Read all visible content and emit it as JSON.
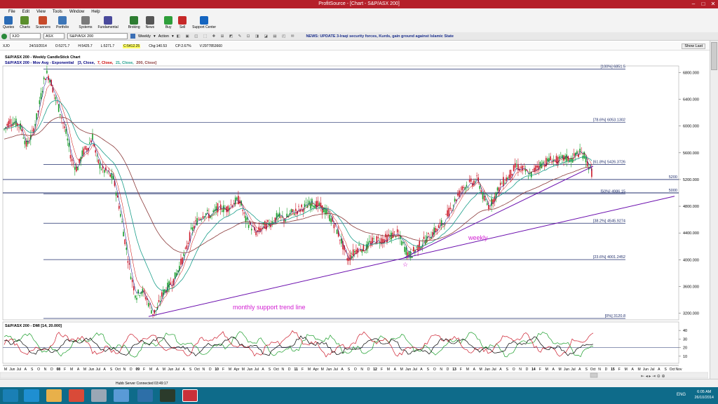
{
  "window": {
    "title": "ProfitSource - [Chart - S&P/ASX 200]"
  },
  "menu": [
    "File",
    "Edit",
    "View",
    "Tools",
    "Window",
    "Help"
  ],
  "toolbar": [
    {
      "label": "Quotes",
      "icon": "quotes-icon",
      "color": "#2a6bb5"
    },
    {
      "label": "Charts",
      "icon": "charts-icon",
      "color": "#5b8f2d"
    },
    {
      "label": "Scanners",
      "icon": "scanners-icon",
      "color": "#c74a2a"
    },
    {
      "label": "Portfolio",
      "icon": "portfolio-icon",
      "color": "#3d76b8"
    },
    {
      "label": "Systems",
      "icon": "systems-icon",
      "color": "#7a7a7a"
    },
    {
      "label": "Fundamental",
      "icon": "fundamental-icon",
      "color": "#4a4a9c"
    },
    {
      "label": "Broking",
      "icon": "broking-icon",
      "color": "#2e7d32"
    },
    {
      "label": "News",
      "icon": "news-icon",
      "color": "#555555"
    },
    {
      "label": "Buy",
      "icon": "buy-icon",
      "color": "#2e9e3a"
    },
    {
      "label": "Sell",
      "icon": "sell-icon",
      "color": "#c62828"
    },
    {
      "label": "Support Center",
      "icon": "help-icon",
      "color": "#1565c0"
    }
  ],
  "symbolbar": {
    "symbol": "XJO",
    "exchange": "ASX",
    "name": "S&P/ASX 200",
    "period": "Weekly",
    "action": "Action",
    "news": "NEWS: UPDATE 3-Iraqi security forces, Kurds, gain ground against Islamic State"
  },
  "quote": {
    "code": "XJO",
    "date": "24/10/2014",
    "open": "O:5271.7",
    "high": "H:5425.7",
    "low": "L:5271.7",
    "close": "C:5412.25",
    "chg": "Chg:140.53",
    "cp": "CP:2.67%",
    "vol": "V:2977853660",
    "show_last": "Show Last"
  },
  "chart_data": {
    "type": "candlestick",
    "title": "S&P/ASX 200 - Weekly CandleStick Chart",
    "indicator": "S&P/ASX 200 - Mov Avg - Exponential",
    "ma_params": [
      "[3, Close,",
      "7, Close,",
      "21, Close,",
      "200, Close]"
    ],
    "ma_colors": [
      "#000080",
      "#cc0000",
      "#1a9e8a",
      "#8b3a3a"
    ],
    "yticks": [
      "6800.000",
      "6400.000",
      "6000.000",
      "5600.000",
      "5200.000",
      "4800.000",
      "4400.000",
      "4000.000",
      "3600.000",
      "3200.000"
    ],
    "ylim": [
      3100,
      6900
    ],
    "fib_levels": [
      {
        "label": "[100%] 6851.5",
        "value": 6851.5
      },
      {
        "label": "[78.6%] 6053.1302",
        "value": 6053.1302
      },
      {
        "label": "[61.8%] 5426.3726",
        "value": 5426.3726
      },
      {
        "label": "[50%] 4986.15",
        "value": 4986.15
      },
      {
        "label": "[38.2%] 4545.9274",
        "value": 4545.9274
      },
      {
        "label": "[23.6%] 4001.2452",
        "value": 4001.2452
      },
      {
        "label": "[0%] 3120.8",
        "value": 3120.8
      }
    ],
    "hlines": [
      {
        "label": "5200",
        "value": 5200
      },
      {
        "label": "5000",
        "value": 5000
      }
    ],
    "close_path": [
      [
        0,
        5950
      ],
      [
        8,
        6080
      ],
      [
        16,
        6050
      ],
      [
        24,
        5980
      ],
      [
        32,
        5700
      ],
      [
        40,
        5880
      ],
      [
        48,
        6200
      ],
      [
        56,
        6650
      ],
      [
        60,
        6800
      ],
      [
        66,
        6700
      ],
      [
        72,
        6450
      ],
      [
        80,
        6200
      ],
      [
        88,
        5900
      ],
      [
        96,
        5500
      ],
      [
        104,
        5350
      ],
      [
        112,
        5600
      ],
      [
        120,
        5700
      ],
      [
        126,
        5850
      ],
      [
        132,
        5500
      ],
      [
        140,
        5350
      ],
      [
        148,
        5300
      ],
      [
        156,
        5200
      ],
      [
        164,
        4800
      ],
      [
        172,
        4300
      ],
      [
        180,
        3800
      ],
      [
        188,
        3450
      ],
      [
        196,
        3550
      ],
      [
        204,
        3400
      ],
      [
        212,
        3200
      ],
      [
        218,
        3250
      ],
      [
        226,
        3500
      ],
      [
        234,
        3600
      ],
      [
        242,
        3700
      ],
      [
        250,
        3900
      ],
      [
        258,
        4100
      ],
      [
        266,
        4400
      ],
      [
        276,
        4600
      ],
      [
        286,
        4700
      ],
      [
        296,
        4650
      ],
      [
        306,
        4800
      ],
      [
        316,
        4750
      ],
      [
        326,
        4850
      ],
      [
        336,
        4900
      ],
      [
        344,
        4600
      ],
      [
        352,
        4500
      ],
      [
        360,
        4400
      ],
      [
        370,
        4500
      ],
      [
        380,
        4550
      ],
      [
        390,
        4650
      ],
      [
        400,
        4600
      ],
      [
        410,
        4700
      ],
      [
        420,
        4750
      ],
      [
        430,
        4800
      ],
      [
        440,
        4850
      ],
      [
        450,
        4800
      ],
      [
        460,
        4700
      ],
      [
        470,
        4550
      ],
      [
        480,
        4300
      ],
      [
        490,
        4000
      ],
      [
        498,
        4100
      ],
      [
        506,
        4200
      ],
      [
        514,
        4150
      ],
      [
        522,
        4250
      ],
      [
        530,
        4300
      ],
      [
        540,
        4300
      ],
      [
        550,
        4350
      ],
      [
        560,
        4400
      ],
      [
        570,
        4200
      ],
      [
        578,
        4050
      ],
      [
        586,
        4150
      ],
      [
        596,
        4250
      ],
      [
        606,
        4350
      ],
      [
        616,
        4450
      ],
      [
        626,
        4550
      ],
      [
        636,
        4750
      ],
      [
        646,
        4950
      ],
      [
        656,
        5100
      ],
      [
        666,
        5150
      ],
      [
        676,
        5200
      ],
      [
        684,
        4900
      ],
      [
        692,
        4800
      ],
      [
        700,
        4950
      ],
      [
        710,
        5150
      ],
      [
        720,
        5250
      ],
      [
        730,
        5400
      ],
      [
        740,
        5350
      ],
      [
        750,
        5250
      ],
      [
        760,
        5400
      ],
      [
        770,
        5450
      ],
      [
        780,
        5500
      ],
      [
        790,
        5480
      ],
      [
        800,
        5520
      ],
      [
        810,
        5500
      ],
      [
        818,
        5600
      ],
      [
        826,
        5580
      ],
      [
        834,
        5400
      ],
      [
        840,
        5250
      ],
      [
        846,
        5400
      ]
    ],
    "trendline_monthly": {
      "label": "monthly support trend line",
      "color": "#6a0dad"
    },
    "trendline_weekly": {
      "label": "weekly",
      "color": "#6a0dad"
    },
    "dmi": {
      "title": "S&P/ASX 200 - DMI [14, 20.000]",
      "yticks": [
        "40",
        "30",
        "20",
        "10"
      ]
    },
    "xticks": [
      "M",
      "Jun",
      "Jul",
      "A",
      "S",
      "O",
      "N",
      "D",
      "08",
      "F",
      "M",
      "A",
      "M",
      "Jun",
      "Jul",
      "A",
      "S",
      "Oct",
      "N",
      "D",
      "09",
      "F",
      "M",
      "A",
      "M",
      "Jun",
      "Jul",
      "A",
      "S",
      "Oct",
      "N",
      "D",
      "10",
      "F",
      "M",
      "Apr",
      "M",
      "Jun",
      "Jul",
      "A",
      "S",
      "Oct",
      "N",
      "D",
      "11",
      "F",
      "M",
      "Apr",
      "M",
      "Jun",
      "Jul",
      "A",
      "S",
      "O",
      "N",
      "D",
      "12",
      "F",
      "M",
      "A",
      "M",
      "Jun",
      "Jul",
      "A",
      "S",
      "O",
      "N",
      "D",
      "13",
      "F",
      "M",
      "A",
      "M",
      "Jun",
      "Jul",
      "A",
      "S",
      "O",
      "N",
      "D",
      "14",
      "F",
      "M",
      "A",
      "M",
      "Jun",
      "Jul",
      "A",
      "S",
      "Oct",
      "N",
      "D",
      "15",
      "F",
      "M",
      "A",
      "M",
      "Jun",
      "Jul",
      "A",
      "S",
      "Oct",
      "Nov"
    ]
  },
  "status": {
    "server": "Hubb Server Connected 03:49:17"
  },
  "taskbar": {
    "lang": "ENG",
    "time": "6:05 AM",
    "date": "26/10/2014"
  }
}
